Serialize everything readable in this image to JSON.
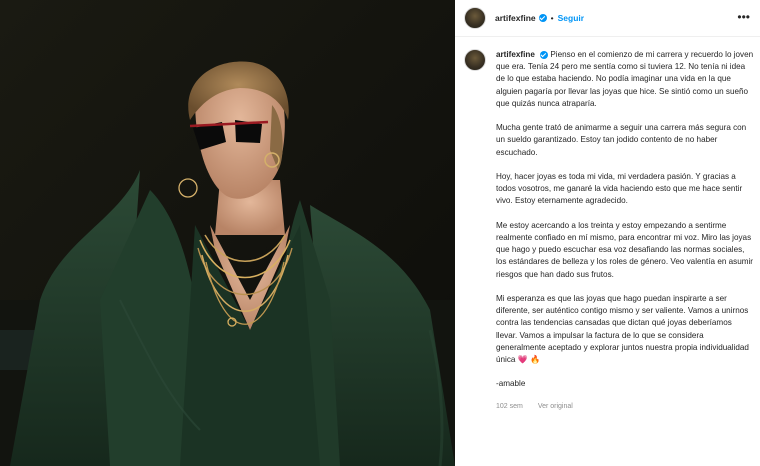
{
  "post": {
    "username": "artifexfine",
    "follow_label": "Seguir",
    "separator": "•",
    "more_label": "•••"
  },
  "caption": {
    "first_line": "Pienso en el comienzo de mi carrera y recuerdo lo joven que era. Tenía 24 pero me sentía como si tuviera 12. No tenía ni idea de lo que estaba haciendo. No podía imaginar una vida en la que alguien pagaría por llevar las joyas que hice. Se sintió como un sueño que quizás nunca atraparía.",
    "p2": "Mucha gente trató de animarme a seguir una carrera más segura con un sueldo garantizado. Estoy tan jodido contento de no haber escuchado.",
    "p3": "Hoy, hacer joyas es toda mi vida, mi verdadera pasión. Y gracias a todos vosotros, me ganaré la vida haciendo esto que me hace sentir vivo. Estoy eternamente agradecido.",
    "p4": "Me estoy acercando a los treinta y estoy empezando a sentirme realmente confiado en mí mismo, para encontrar mi voz. Miro las joyas que hago y puedo escuchar esa voz desafiando las normas sociales, los estándares de belleza y los roles de género. Veo valentía en asumir riesgos que han dado sus frutos.",
    "p5": "Mi esperanza es que las joyas que hago puedan inspirarte a ser diferente, ser auténtico contigo mismo y ser valiente. Vamos a unirnos contra las tendencias cansadas que dictan qué joyas deberíamos llevar. Vamos a impulsar la factura de lo que se considera generalmente aceptado y explorar juntos nuestra propia individualidad única",
    "p5_emojis": "💗 🔥",
    "signature": "-amable"
  },
  "meta": {
    "age": "102 sem",
    "see_original": "Ver original"
  },
  "colors": {
    "accent": "#0095f6",
    "jacket": "#1f3a2a",
    "background": "#0c0c0a"
  },
  "icons": [
    "verified-badge-icon",
    "more-options-icon",
    "heart-emoji-icon",
    "fire-emoji-icon"
  ]
}
